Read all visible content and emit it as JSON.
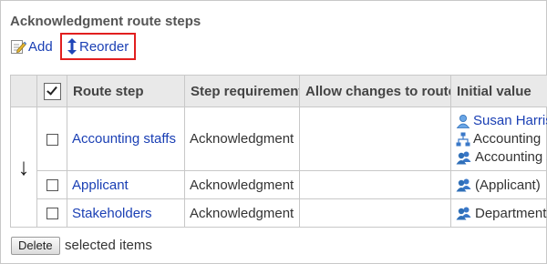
{
  "section": {
    "title": "Acknowledgment route steps"
  },
  "toolbar": {
    "add_label": "Add",
    "reorder_label": "Reorder"
  },
  "table": {
    "headers": {
      "route_step": "Route step",
      "step_requirement": "Step requirement",
      "allow_changes": "Allow changes to route",
      "initial_value": "Initial value"
    },
    "rows": [
      {
        "route_step": "Accounting staffs",
        "step_requirement": "Acknowledgment",
        "allow_changes": "",
        "initial_value": [
          "Susan Harris",
          "Accounting",
          "Accounting s"
        ]
      },
      {
        "route_step": "Applicant",
        "step_requirement": "Acknowledgment",
        "allow_changes": "",
        "initial_value": [
          "(Applicant)"
        ]
      },
      {
        "route_step": "Stakeholders",
        "step_requirement": "Acknowledgment",
        "allow_changes": "",
        "initial_value": [
          "Department"
        ]
      }
    ]
  },
  "footer": {
    "delete_label": "Delete",
    "selected_items_label": "selected items"
  },
  "colors": {
    "link": "#1a3fb4",
    "highlight_border": "#e11f1f",
    "header_bg": "#e9e9e9"
  },
  "icons": {
    "add": "edit-note-icon",
    "reorder": "up-down-arrow-icon",
    "user": "user-icon",
    "org": "organization-icon",
    "group": "users-group-icon"
  }
}
